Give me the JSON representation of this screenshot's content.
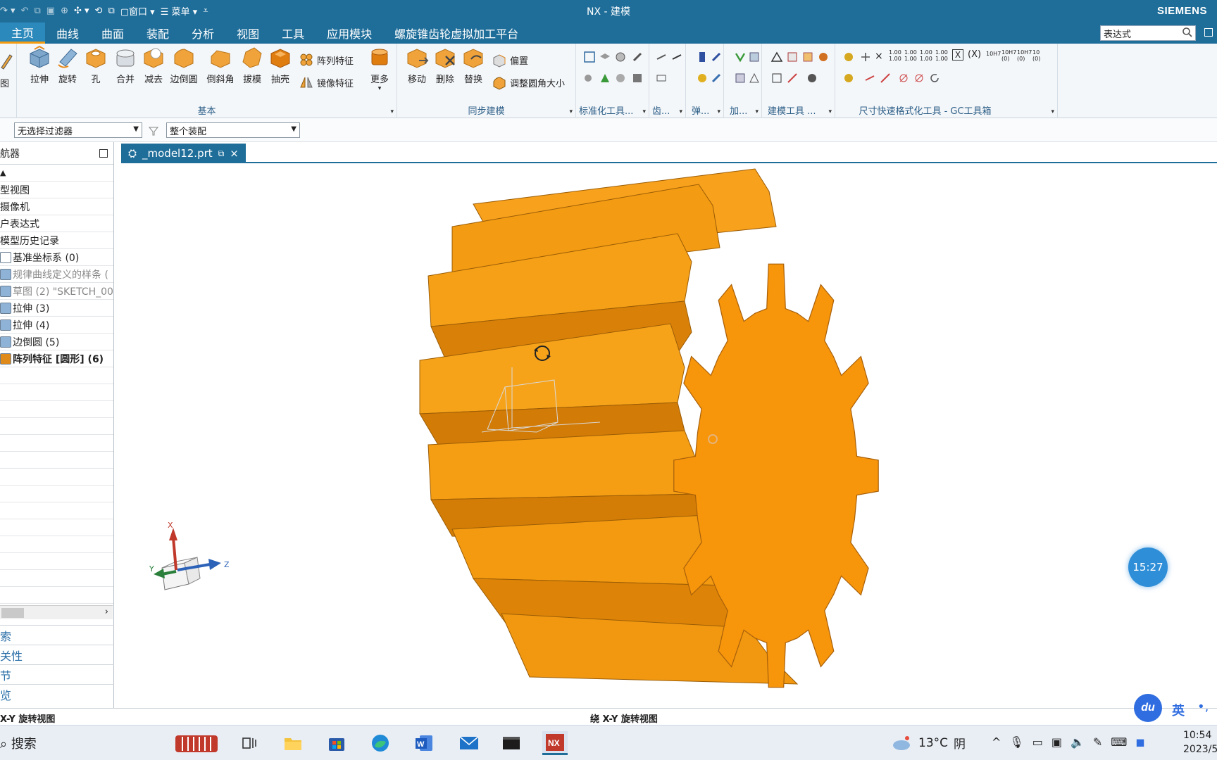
{
  "titlebar": {
    "title": "NX - 建模",
    "brand": "SIEMENS",
    "window_menu": "窗口",
    "menu_label": "☰ 菜单"
  },
  "menubar": {
    "tabs": [
      "主页",
      "曲线",
      "曲面",
      "装配",
      "分析",
      "视图",
      "工具",
      "应用模块",
      "螺旋锥齿轮虚拟加工平台"
    ],
    "active_tab": "主页",
    "search_value": "表达式"
  },
  "ribbon": {
    "basic_group": "基本",
    "sync_group": "同步建模",
    "buttons": [
      "拉伸",
      "旋转",
      "孔",
      "合并",
      "减去",
      "边倒圆",
      "倒斜角",
      "拔模",
      "抽壳"
    ],
    "small": {
      "pattern": "阵列特征",
      "mirror": "镜像特征",
      "more": "更多"
    },
    "sync_buttons": [
      "移动",
      "删除",
      "替换"
    ],
    "sync_small": {
      "offset": "偏置",
      "resize_blend": "调整圆角大小"
    },
    "std_group": "标准化工具...",
    "gear_group": "齿...",
    "spring_group": "弹...",
    "machining_group": "加...",
    "model_tools_group": "建模工具 ...",
    "dim_group": "尺寸快速格式化工具 - GC工具箱",
    "left_partial_label": "图"
  },
  "filterbar": {
    "filter": "无选择过滤器",
    "assembly": "整个装配"
  },
  "navigator": {
    "title": "航器",
    "rows": [
      {
        "text": "型视图"
      },
      {
        "text": "摄像机"
      },
      {
        "text": "户表达式"
      },
      {
        "text": "模型历史记录"
      },
      {
        "text": "基准坐标系 (0)",
        "icon": "datum-csys-icon"
      },
      {
        "text": "规律曲线定义的样条 (",
        "icon": "spline-icon",
        "dim": true
      },
      {
        "text": "草图 (2) \"SKETCH_00",
        "icon": "sketch-icon",
        "dim": true
      },
      {
        "text": "拉伸 (3)",
        "icon": "extrude-icon"
      },
      {
        "text": "拉伸 (4)",
        "icon": "extrude-icon"
      },
      {
        "text": "边倒圆 (5)",
        "icon": "edge-blend-icon"
      },
      {
        "text": "阵列特征 [圆形] (6)",
        "icon": "pattern-icon",
        "bold": true
      }
    ],
    "panels": [
      "索",
      "关性",
      "节",
      "览"
    ]
  },
  "viewport": {
    "file_tab": "_model12.prt",
    "timer": "15:27",
    "axis": {
      "x": "X",
      "y": "Y",
      "z": "Z"
    }
  },
  "statusbar": {
    "left": "X-Y 旋转视图",
    "center": "绕 X-Y 旋转视图"
  },
  "ime": {
    "du": "du",
    "lang": "英"
  },
  "taskbar": {
    "search": "搜索",
    "temperature": "13°C",
    "weather": "阴",
    "time": "10:54",
    "date": "2023/5"
  },
  "colors": {
    "accent": "#1f6e9a",
    "gear": "#f7950b",
    "gear_dark": "#d07808"
  }
}
